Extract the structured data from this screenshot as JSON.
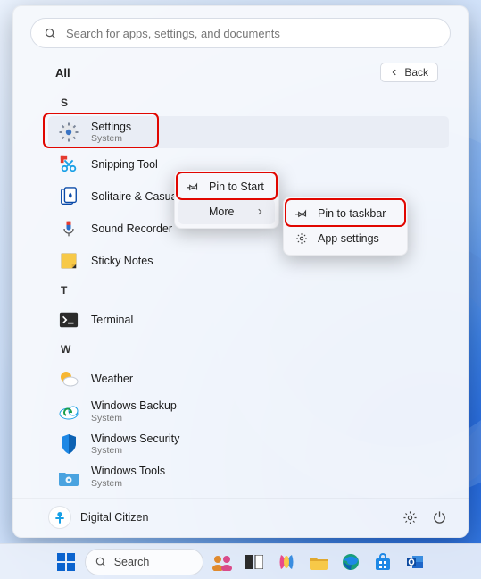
{
  "search": {
    "placeholder": "Search for apps, settings, and documents"
  },
  "header": {
    "all": "All",
    "back": "Back"
  },
  "letters": {
    "s": "S",
    "t": "T",
    "w": "W"
  },
  "apps": {
    "settings": {
      "name": "Settings",
      "sub": "System"
    },
    "snipping": {
      "name": "Snipping Tool"
    },
    "solitaire": {
      "name": "Solitaire & Casual Games"
    },
    "sound": {
      "name": "Sound Recorder"
    },
    "sticky": {
      "name": "Sticky Notes"
    },
    "terminal": {
      "name": "Terminal"
    },
    "weather": {
      "name": "Weather"
    },
    "backup": {
      "name": "Windows Backup",
      "sub": "System"
    },
    "security": {
      "name": "Windows Security",
      "sub": "System"
    },
    "tools": {
      "name": "Windows Tools",
      "sub": "System"
    }
  },
  "ctx1": {
    "pin_start": "Pin to Start",
    "more": "More"
  },
  "ctx2": {
    "pin_taskbar": "Pin to taskbar",
    "app_settings": "App settings"
  },
  "footer": {
    "user": "Digital Citizen"
  },
  "taskbar": {
    "search": "Search"
  }
}
